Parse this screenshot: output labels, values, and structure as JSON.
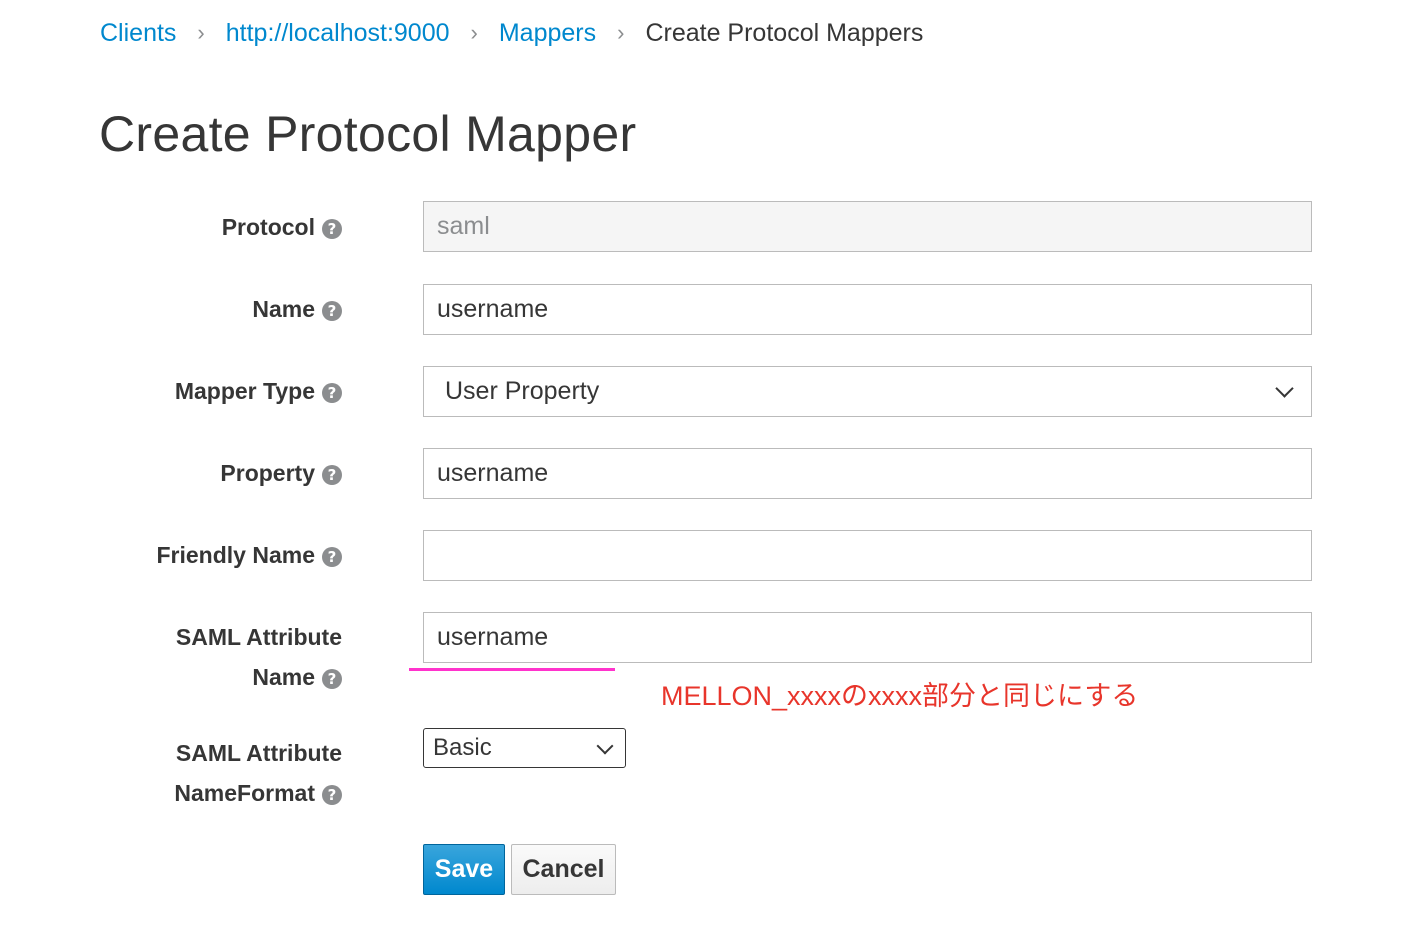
{
  "breadcrumb": {
    "items": [
      "Clients",
      "http://localhost:9000",
      "Mappers"
    ],
    "separator": "›",
    "current": "Create Protocol Mappers"
  },
  "page_title": "Create Protocol Mapper",
  "form": {
    "protocol": {
      "label": "Protocol",
      "value": "saml"
    },
    "name": {
      "label": "Name",
      "value": "username"
    },
    "mapper_type": {
      "label": "Mapper Type",
      "value": "User Property"
    },
    "property": {
      "label": "Property",
      "value": "username"
    },
    "friendly_name": {
      "label": "Friendly Name",
      "value": ""
    },
    "saml_attribute_name": {
      "label_line1": "SAML Attribute",
      "label_line2": "Name",
      "value": "username"
    },
    "saml_attribute_nameformat": {
      "label_line1": "SAML Attribute",
      "label_line2": "NameFormat",
      "value": "Basic"
    }
  },
  "help_icon_glyph": "?",
  "annotation": {
    "text": "MELLON_xxxxのxxxx部分と同じにする",
    "text_color": "#e8352b",
    "underline_color": "#ff33cc"
  },
  "buttons": {
    "save": "Save",
    "cancel": "Cancel"
  },
  "colors": {
    "link": "#0088ce",
    "primary": "#0088ce",
    "text": "#363636"
  }
}
